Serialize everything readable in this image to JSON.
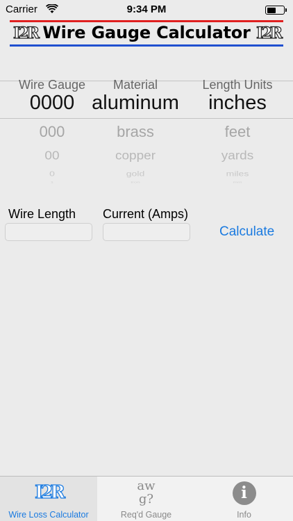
{
  "status_bar": {
    "carrier": "Carrier",
    "time": "9:34 PM",
    "battery_level": 0.55
  },
  "banner": {
    "title": "Wire Gauge Calculator",
    "logo_text": "I2R"
  },
  "picker": {
    "columns": [
      {
        "header": "Wire Gauge",
        "selected": "0000",
        "below": [
          "000",
          "00",
          "0",
          "1"
        ]
      },
      {
        "header": "Material",
        "selected": "aluminum",
        "below": [
          "brass",
          "copper",
          "gold",
          "iron"
        ]
      },
      {
        "header": "Length Units",
        "selected": "inches",
        "below": [
          "feet",
          "yards",
          "miles",
          "mm"
        ]
      }
    ]
  },
  "inputs": {
    "wire_length": {
      "label": "Wire Length",
      "value": ""
    },
    "current": {
      "label": "Current (Amps)",
      "value": ""
    }
  },
  "calculate_label": "Calculate",
  "tabs": [
    {
      "label": "Wire Loss Calculator",
      "icon_text": "I2R",
      "selected": true
    },
    {
      "label": "Req'd Gauge",
      "icon_text_line1": "aw",
      "icon_text_line2": "g?",
      "selected": false
    },
    {
      "label": "Info",
      "icon_text": "i",
      "selected": false
    }
  ],
  "colors": {
    "accent": "#1a7ae0",
    "banner_red": "#e02020",
    "banner_blue": "#2050d0",
    "background": "#ebebeb"
  }
}
